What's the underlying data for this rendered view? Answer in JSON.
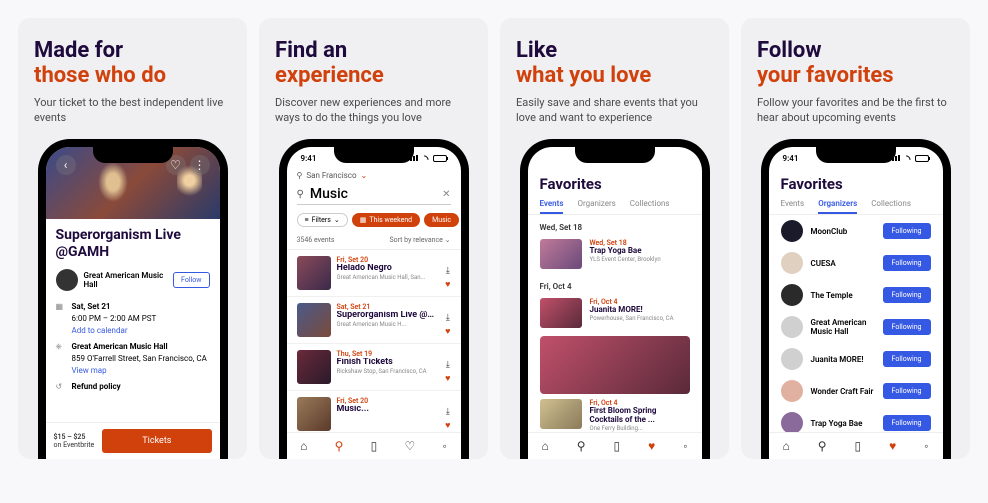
{
  "panels": [
    {
      "h1": "Made for",
      "h2": "those who do",
      "sub": "Your ticket to the best independent live events"
    },
    {
      "h1": "Find an",
      "h2": "experience",
      "sub": "Discover new experiences and more ways to do the things you love"
    },
    {
      "h1": "Like",
      "h2": "what you love",
      "sub": "Easily save and share events that you love and want to experience"
    },
    {
      "h1": "Follow",
      "h2": "your favorites",
      "sub": "Follow your favorites and be the first to hear about upcoming events"
    }
  ],
  "status_time": "9:41",
  "p1": {
    "event_title": "Superorganism Live @GAMH",
    "org_name": "Great American Music Hall",
    "follow": "Follow",
    "date": "Sat, Set 21",
    "time": "6:00 PM – 2:00 AM PST",
    "add_cal": "Add to calendar",
    "venue": "Great American Music Hall",
    "addr": "859 O'Farrell Street, San Francisco, CA",
    "view_map": "View map",
    "refund": "Refund policy",
    "price": "$15 – $25",
    "price_sub": "on Eventbrite",
    "tickets": "Tickets"
  },
  "p2": {
    "location": "San Francisco",
    "search": "Music",
    "filters": "Filters",
    "chip_weekend": "This weekend",
    "chip_music": "Music",
    "count": "3546 events",
    "sort": "Sort by relevance",
    "results": [
      {
        "date": "Fri, Set 20",
        "title": "Helado Negro",
        "venue": "Great American Music Hall, San...",
        "bg": "linear-gradient(135deg,#8a4a5a,#3a2a4a)"
      },
      {
        "date": "Sat, Set 21",
        "title": "Superorganism Live @GAMH",
        "venue": "Great American Music H...",
        "bg": "linear-gradient(135deg,#4a5a8a,#7a4a3a)"
      },
      {
        "date": "Thu, Set 19",
        "title": "Finish Tickets",
        "venue": "Rickshaw Stop, San Francisco, CA",
        "bg": "linear-gradient(135deg,#6a2a3a,#2a1a2a)"
      },
      {
        "date": "Fri, Set 20",
        "title": "Music...",
        "venue": "",
        "bg": "linear-gradient(135deg,#9a7a5a,#5a3a2a)"
      }
    ]
  },
  "p3": {
    "title": "Favorites",
    "tabs": [
      "Events",
      "Organizers",
      "Collections"
    ],
    "sect1": "Wed, Set 18",
    "ev1": {
      "date": "Wed, Set 18",
      "title": "Trap Yoga Bae",
      "venue": "YLS Event Center, Brooklyn",
      "bg": "linear-gradient(135deg,#c07a9a,#6a4a7a)"
    },
    "sect2": "Fri, Oct 4",
    "ev2": {
      "date": "Fri, Oct 4",
      "title": "Juanita MORE!",
      "venue": "Powerhouse, San Francisco, CA",
      "bg": "linear-gradient(135deg,#c0506a,#5a2a3a)"
    },
    "ev3": {
      "date": "Fri, Oct 4",
      "title": "First Bloom Spring Cocktails of the ...",
      "venue": "One Ferry Building...",
      "bg": "linear-gradient(135deg,#d0c090,#8a7a5a)"
    }
  },
  "p4": {
    "title": "Favorites",
    "tabs": [
      "Events",
      "Organizers",
      "Collections"
    ],
    "following": "Following",
    "orgs": [
      {
        "name": "MoonClub",
        "bg": "#1a1a2a"
      },
      {
        "name": "CUESA",
        "bg": "#e0d0c0"
      },
      {
        "name": "The Temple",
        "bg": "#2a2a2a"
      },
      {
        "name": "Great American Music Hall",
        "bg": "#d0d0d0"
      },
      {
        "name": "Juanita MORE!",
        "bg": "#d0d0d0"
      },
      {
        "name": "Wonder Craft Fair",
        "bg": "#e0b0a0"
      },
      {
        "name": "Trap Yoga Bae",
        "bg": "#8a6a9a"
      }
    ]
  }
}
